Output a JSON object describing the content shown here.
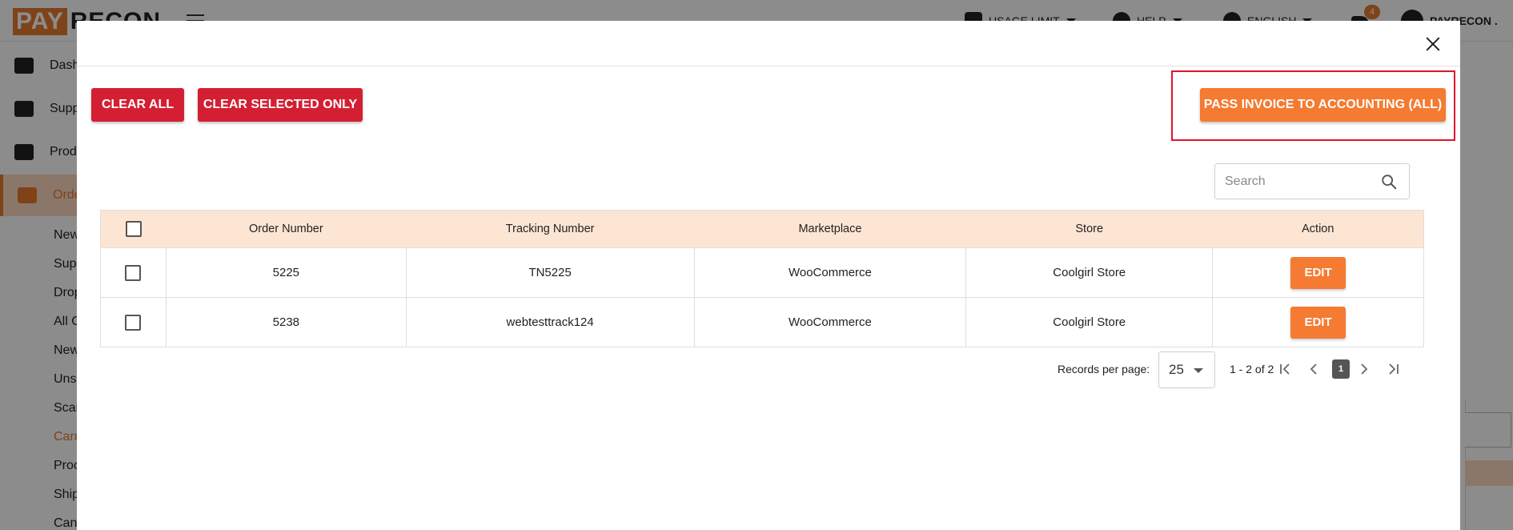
{
  "app": {
    "logo_part1": "PAY",
    "logo_part2": "RECON",
    "topbar": {
      "usage_limit": "USAGE LIMIT",
      "help": "HELP",
      "language": "ENGLISH",
      "notification_count": "4",
      "user_name": "PAYRECON ."
    },
    "sidebar": {
      "items": [
        {
          "label": "Dashboard",
          "icon": "chart-line-icon"
        },
        {
          "label": "Suppliers",
          "icon": "users-icon"
        },
        {
          "label": "Products",
          "icon": "inbox-icon"
        },
        {
          "label": "Orders",
          "icon": "clipboard-icon"
        }
      ],
      "sub_items": [
        "New",
        "Sup",
        "Drop",
        "All O",
        "New",
        "Unse",
        "Scan",
        "Carr",
        "Proc",
        "Ship",
        "Canc"
      ]
    }
  },
  "modal": {
    "clear_all_label": "CLEAR ALL",
    "clear_selected_label": "CLEAR SELECTED ONLY",
    "pass_invoice_label": "PASS INVOICE TO ACCOUNTING (ALL)",
    "search_placeholder": "Search",
    "table": {
      "columns": [
        "Order Number",
        "Tracking Number",
        "Marketplace",
        "Store",
        "Action"
      ],
      "rows": [
        {
          "order_number": "5225",
          "tracking_number": "TN5225",
          "marketplace": "WooCommerce",
          "store": "Coolgirl Store",
          "action": "EDIT"
        },
        {
          "order_number": "5238",
          "tracking_number": "webtesttrack124",
          "marketplace": "WooCommerce",
          "store": "Coolgirl Store",
          "action": "EDIT"
        }
      ]
    },
    "pagination": {
      "records_per_page_label": "Records per page:",
      "records_per_page": "25",
      "range": "1 - 2 of 2",
      "current_page": "1"
    }
  },
  "colors": {
    "brand_orange": "#f47b31",
    "danger_red": "#d41f33",
    "header_row": "#fde5d4",
    "highlight": "#e0142c"
  }
}
